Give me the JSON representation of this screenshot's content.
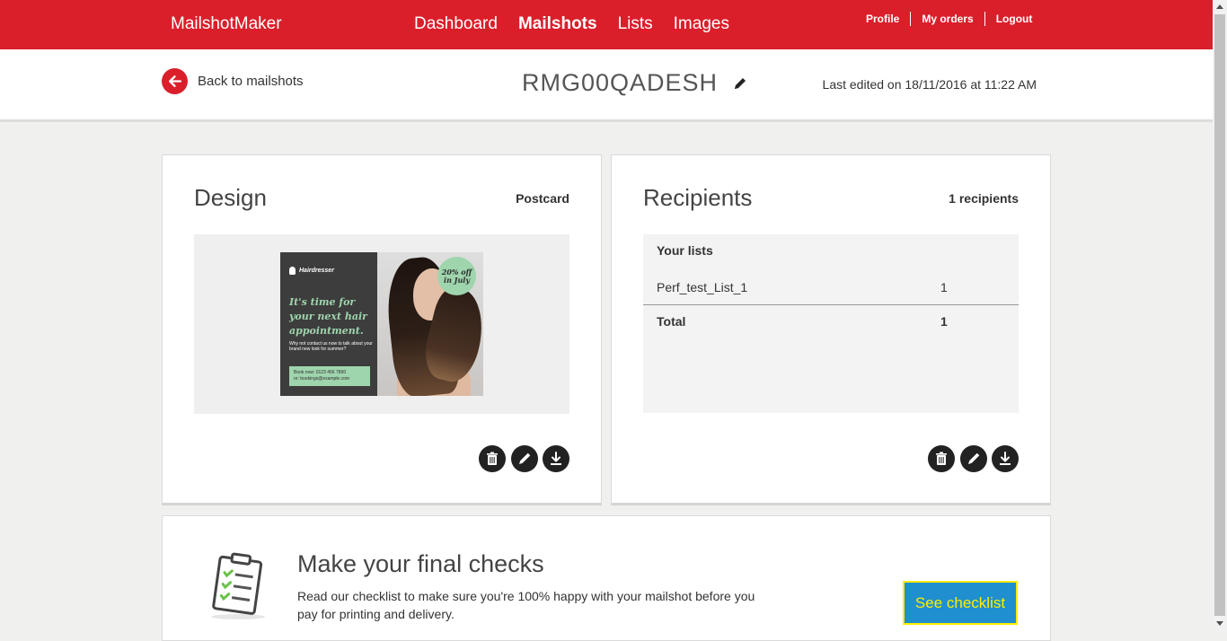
{
  "header": {
    "brand": "MailshotMaker",
    "nav": [
      {
        "label": "Dashboard",
        "active": false
      },
      {
        "label": "Mailshots",
        "active": true
      },
      {
        "label": "Lists",
        "active": false
      },
      {
        "label": "Images",
        "active": false
      }
    ],
    "user_links": [
      "Profile",
      "My orders",
      "Logout"
    ],
    "accent_color": "#da1f2b"
  },
  "subheader": {
    "back_label": "Back to mailshots",
    "mailshot_title": "RMG00QADESH",
    "last_edited": "Last edited on 18/11/2016 at 11:22 AM"
  },
  "design": {
    "heading": "Design",
    "format": "Postcard",
    "postcard": {
      "brand": "Hairdresser",
      "headline": "It's time for your next hair appointment.",
      "body": "Why not contact us now to talk about your brand new look for summer?",
      "cta_line1": "Book now: 0123 456 7890",
      "cta_line2": "or: bookings@example.com",
      "badge": "20% off in July"
    },
    "actions": [
      "delete-icon",
      "pencil-icon",
      "download-icon"
    ]
  },
  "recipients": {
    "heading": "Recipients",
    "count_label": "1 recipients",
    "lists_heading": "Your lists",
    "rows": [
      {
        "name": "Perf_test_List_1",
        "count": "1"
      }
    ],
    "total_label": "Total",
    "total_value": "1",
    "actions": [
      "delete-icon",
      "pencil-icon",
      "download-icon"
    ]
  },
  "checks": {
    "title": "Make your final checks",
    "text": "Read our checklist to make sure you're 100% happy with your mailshot before you pay for printing and delivery.",
    "button_label": "See checklist",
    "button_color": "#1f8fd0",
    "button_text_color": "#ffed00"
  }
}
